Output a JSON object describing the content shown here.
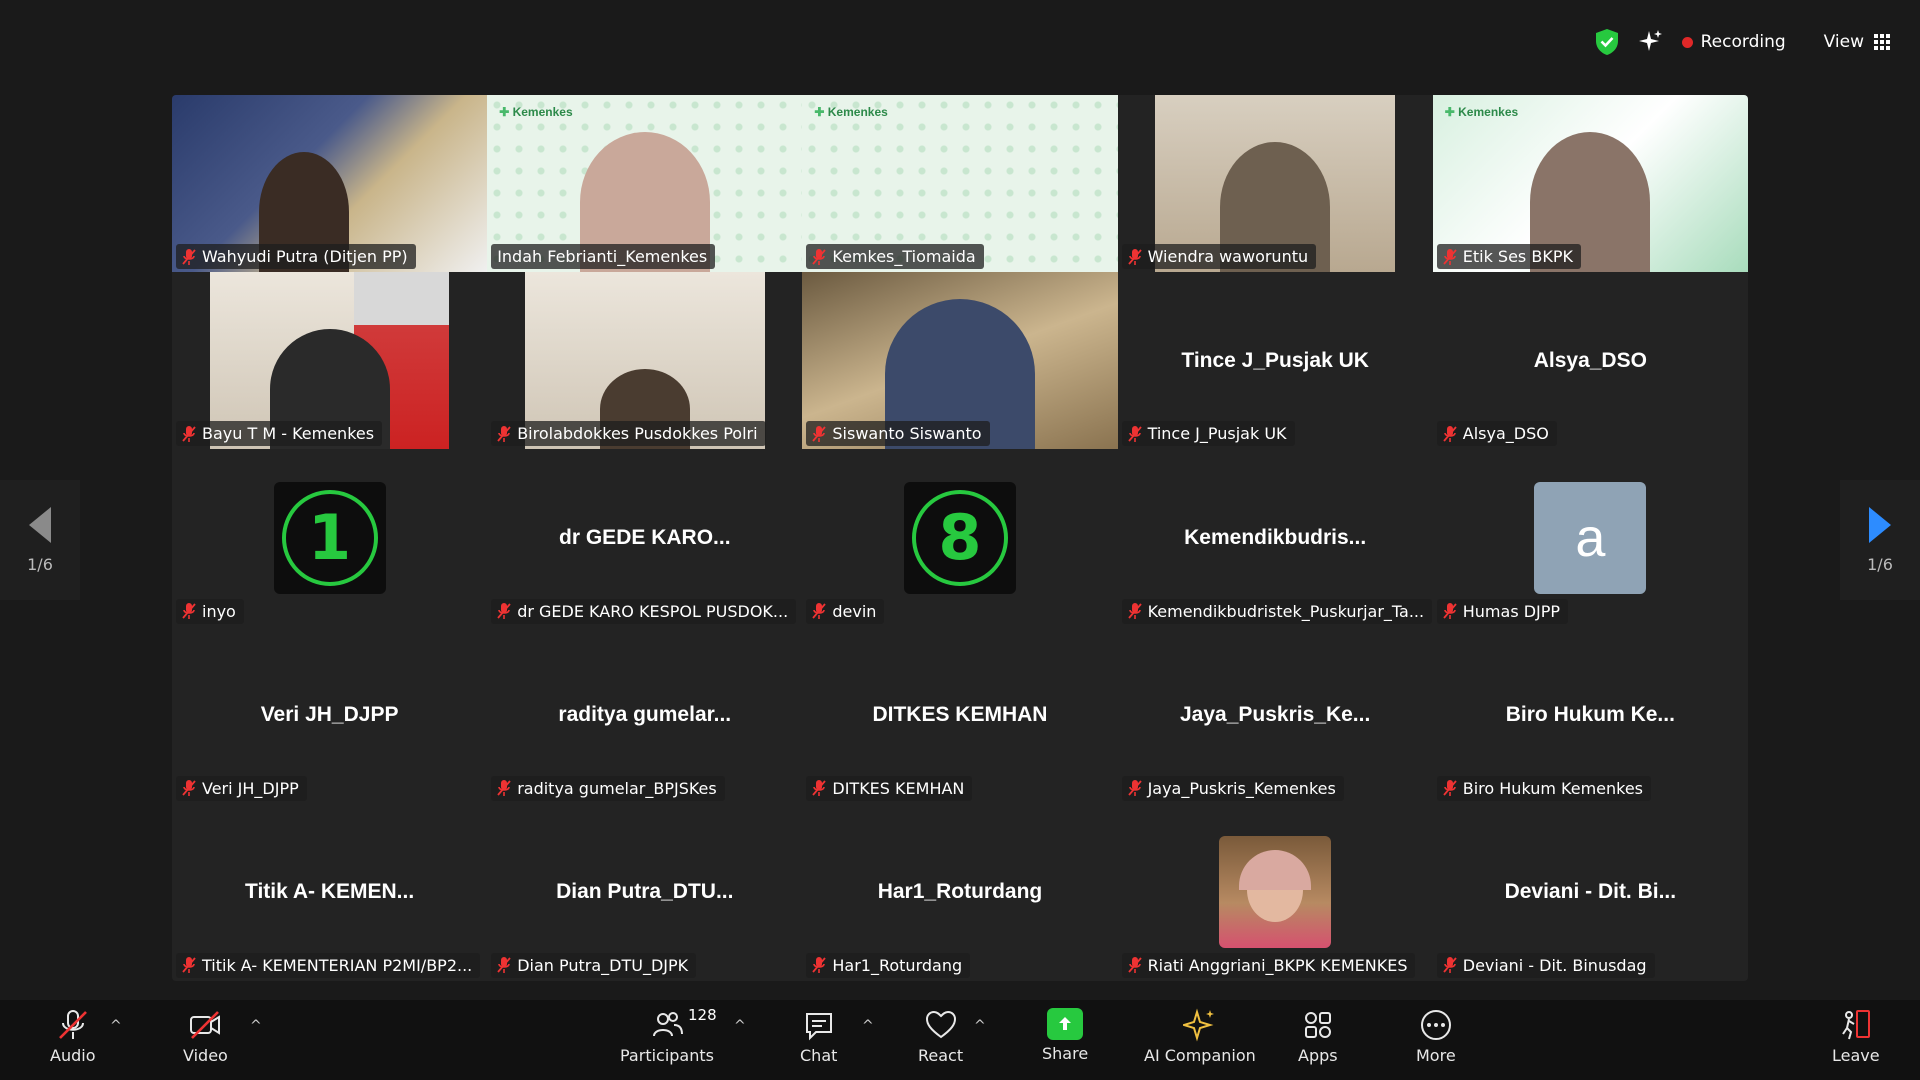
{
  "topbar": {
    "recording_label": "Recording",
    "view_label": "View"
  },
  "tiles": [
    {
      "label": "Wahyudi Putra (Ditjen PP)",
      "type": "video"
    },
    {
      "label": "Indah Febrianti_Kemenkes",
      "type": "video",
      "active": true
    },
    {
      "label": "Kemkes_Tiomaida",
      "type": "video"
    },
    {
      "label": "Wiendra waworuntu",
      "type": "video"
    },
    {
      "label": "Etik Ses BKPK",
      "type": "video"
    },
    {
      "label": "Bayu T M - Kemenkes",
      "type": "video"
    },
    {
      "label": "Birolabdokkes Pusdokkes Polri",
      "type": "video"
    },
    {
      "label": "Siswanto Siswanto",
      "type": "video"
    },
    {
      "label": "Tince J_Pusjak UK",
      "center": "Tince J_Pusjak UK",
      "type": "name"
    },
    {
      "label": "Alsya_DSO",
      "center": "Alsya_DSO",
      "type": "name"
    },
    {
      "label": "inyo",
      "type": "timer",
      "digit": "1"
    },
    {
      "label": "dr GEDE KARO KESPOL PUSDOK...",
      "center": "dr GEDE KARO...",
      "type": "name"
    },
    {
      "label": "devin",
      "type": "timer",
      "digit": "8"
    },
    {
      "label": "Kemendikbudristek_Puskurjar_Ta...",
      "center": "Kemendikbudris...",
      "type": "name"
    },
    {
      "label": "Humas DJPP",
      "type": "letter",
      "letter": "a"
    },
    {
      "label": "Veri JH_DJPP",
      "center": "Veri JH_DJPP",
      "type": "name"
    },
    {
      "label": "raditya gumelar_BPJSKes",
      "center": "raditya  gumelar...",
      "type": "name"
    },
    {
      "label": "DITKES KEMHAN",
      "center": "DITKES KEMHAN",
      "type": "name"
    },
    {
      "label": "Jaya_Puskris_Kemenkes",
      "center": "Jaya_Puskris_Ke...",
      "type": "name"
    },
    {
      "label": "Biro Hukum Kemenkes",
      "center": "Biro  Hukum  Ke...",
      "type": "name"
    },
    {
      "label": "Titik A- KEMENTERIAN P2MI/BP2...",
      "center": "Titik  A-  KEMEN...",
      "type": "name"
    },
    {
      "label": "Dian Putra_DTU_DJPK",
      "center": "Dian  Putra_DTU...",
      "type": "name"
    },
    {
      "label": "Har1_Roturdang",
      "center": "Har1_Roturdang",
      "type": "name"
    },
    {
      "label": "Riati Anggriani_BKPK KEMENKES",
      "type": "photo"
    },
    {
      "label": "Deviani - Dit. Binusdag",
      "center": "Deviani  -  Dit.  Bi...",
      "type": "name"
    }
  ],
  "nav": {
    "left_page": "1/6",
    "right_page": "1/6"
  },
  "toolbar": {
    "audio": "Audio",
    "video": "Video",
    "participants": "Participants",
    "participants_count": "128",
    "chat": "Chat",
    "react": "React",
    "share": "Share",
    "ai_companion": "AI Companion",
    "apps": "Apps",
    "more": "More",
    "leave": "Leave"
  },
  "colors": {
    "accent_green": "#27c93f",
    "recording_red": "#e02828",
    "nav_blue": "#2d8cff"
  }
}
